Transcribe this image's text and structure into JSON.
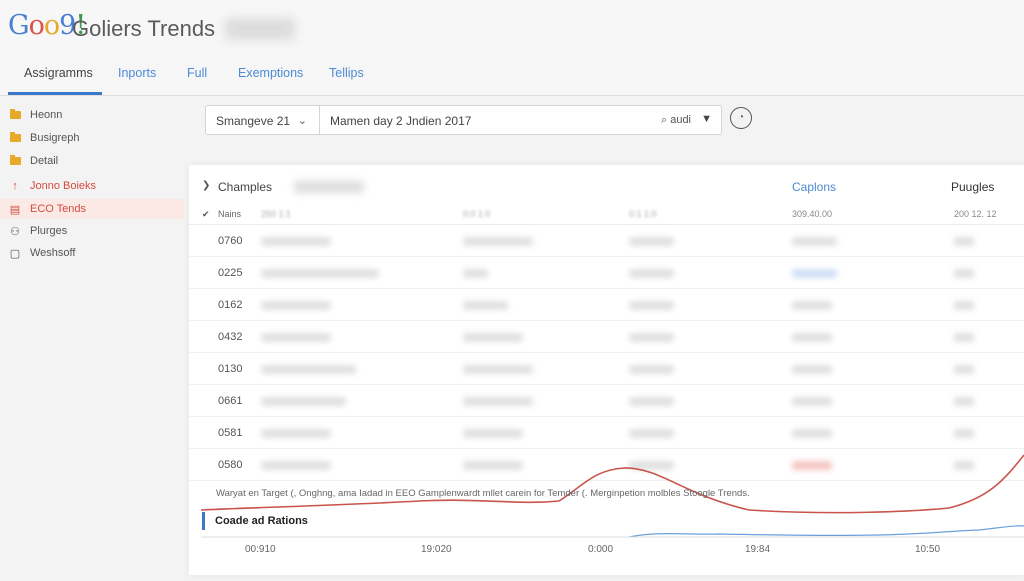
{
  "header": {
    "logo_letters": [
      "G",
      "o",
      "o",
      "9",
      "!"
    ],
    "title": "Goliers Trends"
  },
  "tabs": [
    {
      "label": "Assigramms",
      "active": true
    },
    {
      "label": "Inports",
      "active": false
    },
    {
      "label": "Full",
      "active": false
    },
    {
      "label": "Exemptions",
      "active": false
    },
    {
      "label": "Tellips",
      "active": false
    }
  ],
  "sidebar": {
    "items": [
      {
        "label": "Heonn",
        "icon": "folder-icon"
      },
      {
        "label": "Busigreph",
        "icon": "folder-icon"
      },
      {
        "label": "Detail",
        "icon": "folder-icon"
      },
      {
        "label": "Jonno Boieks",
        "icon": "arrow-up-icon",
        "color": "#d64b3e"
      },
      {
        "label": "ECO Tends",
        "icon": "document-icon",
        "color": "#d64b3e",
        "selected": true
      },
      {
        "label": "Plurges",
        "icon": "people-icon"
      },
      {
        "label": "Weshsoff",
        "icon": "square-icon"
      }
    ]
  },
  "filters": {
    "selector_value": "Smangeve 21",
    "query_value": "Mamen day 2 Jndien 2017",
    "lang_value": "audi"
  },
  "panel": {
    "title": "Champles",
    "captions_label": "Caplons",
    "plugins_label": "Puugles",
    "subhead_check": "✔",
    "subhead_label": "Nains",
    "subhead_values": [
      "250 1:1",
      "0:0 1:0",
      "0:1 1:0",
      "309.40.00",
      "200 12. 12"
    ],
    "rows": [
      "0760",
      "0225",
      "0162",
      "0432",
      "0130",
      "0661",
      "0581",
      "0580"
    ],
    "note": "Waryat en Target (, Onghng, ama Iadad in EEO Gamplenwardt mllet carein for Temder (. Merginpetion molbles Stoogle Trends.",
    "bottom_label": "Coade ad Rations",
    "x_ticks": [
      "00:910",
      "19:020",
      "0:000",
      "19:84",
      "10:50"
    ]
  },
  "colors": {
    "accent_blue": "#3b78c9",
    "link_blue": "#4c8ad6",
    "trend_red": "#c9544b",
    "trend_blue": "#6a9fd8"
  }
}
